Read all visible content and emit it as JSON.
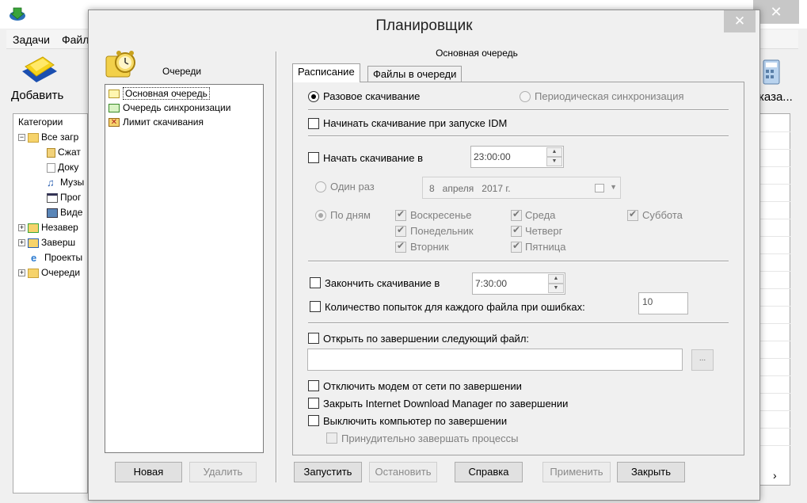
{
  "background": {
    "menu": [
      "Задачи",
      "Файл"
    ],
    "toolbar": {
      "add_label": "Добавить",
      "right_label": "каза..."
    },
    "categories": {
      "header": "Категории",
      "items": [
        {
          "label": "Все загр",
          "pm": "−"
        },
        {
          "label": "Сжат"
        },
        {
          "label": "Доку"
        },
        {
          "label": "Музы"
        },
        {
          "label": "Прог"
        },
        {
          "label": "Виде"
        },
        {
          "label": "Незавер",
          "pm": "+"
        },
        {
          "label": "Заверш",
          "pm": "+"
        },
        {
          "label": "Проекты"
        },
        {
          "label": "Очереди",
          "pm": "+"
        }
      ]
    },
    "close_glyph": "✕",
    "scroll_glyph": "›"
  },
  "dialog": {
    "title": "Планировщик",
    "close_glyph": "✕",
    "queues_label": "Очереди",
    "queues": [
      {
        "label": "Основная очередь",
        "selected": true
      },
      {
        "label": "Очередь синхронизации",
        "selected": false
      },
      {
        "label": "Лимит скачивания",
        "selected": false
      }
    ],
    "new_button": "Новая",
    "delete_button": "Удалить",
    "queue_name": "Основная очередь",
    "tabs": [
      "Расписание",
      "Файлы в очереди"
    ],
    "schedule": {
      "one_time_download": "Разовое скачивание",
      "periodic_sync": "Периодическая синхронизация",
      "start_on_idm_startup": "Начинать скачивание при запуске IDM",
      "start_at_label": "Начать скачивание в",
      "start_time": "23:00:00",
      "once_label": "Один раз",
      "date_value": "8   апреля   2017 г.",
      "daily_label": "По дням",
      "days": {
        "sunday": "Воскресенье",
        "monday": "Понедельник",
        "tuesday": "Вторник",
        "wednesday": "Среда",
        "thursday": "Четверг",
        "friday": "Пятница",
        "saturday": "Суббота"
      },
      "stop_at_label": "Закончить скачивание в",
      "stop_time": "7:30:00",
      "retries_label": "Количество попыток для каждого файла при ошибках:",
      "retries_value": "10",
      "open_file_label": "Открыть по завершении следующий файл:",
      "open_file_value": "",
      "browse_label": "...",
      "hangup_modem": "Отключить модем от сети по завершении",
      "exit_idm": "Закрыть Internet Download Manager по завершении",
      "shutdown_pc": "Выключить компьютер по завершении",
      "force_terminate": "Принудительно завершать процессы"
    },
    "buttons": {
      "start": "Запустить",
      "stop": "Остановить",
      "help": "Справка",
      "apply": "Применить",
      "close": "Закрыть"
    }
  }
}
